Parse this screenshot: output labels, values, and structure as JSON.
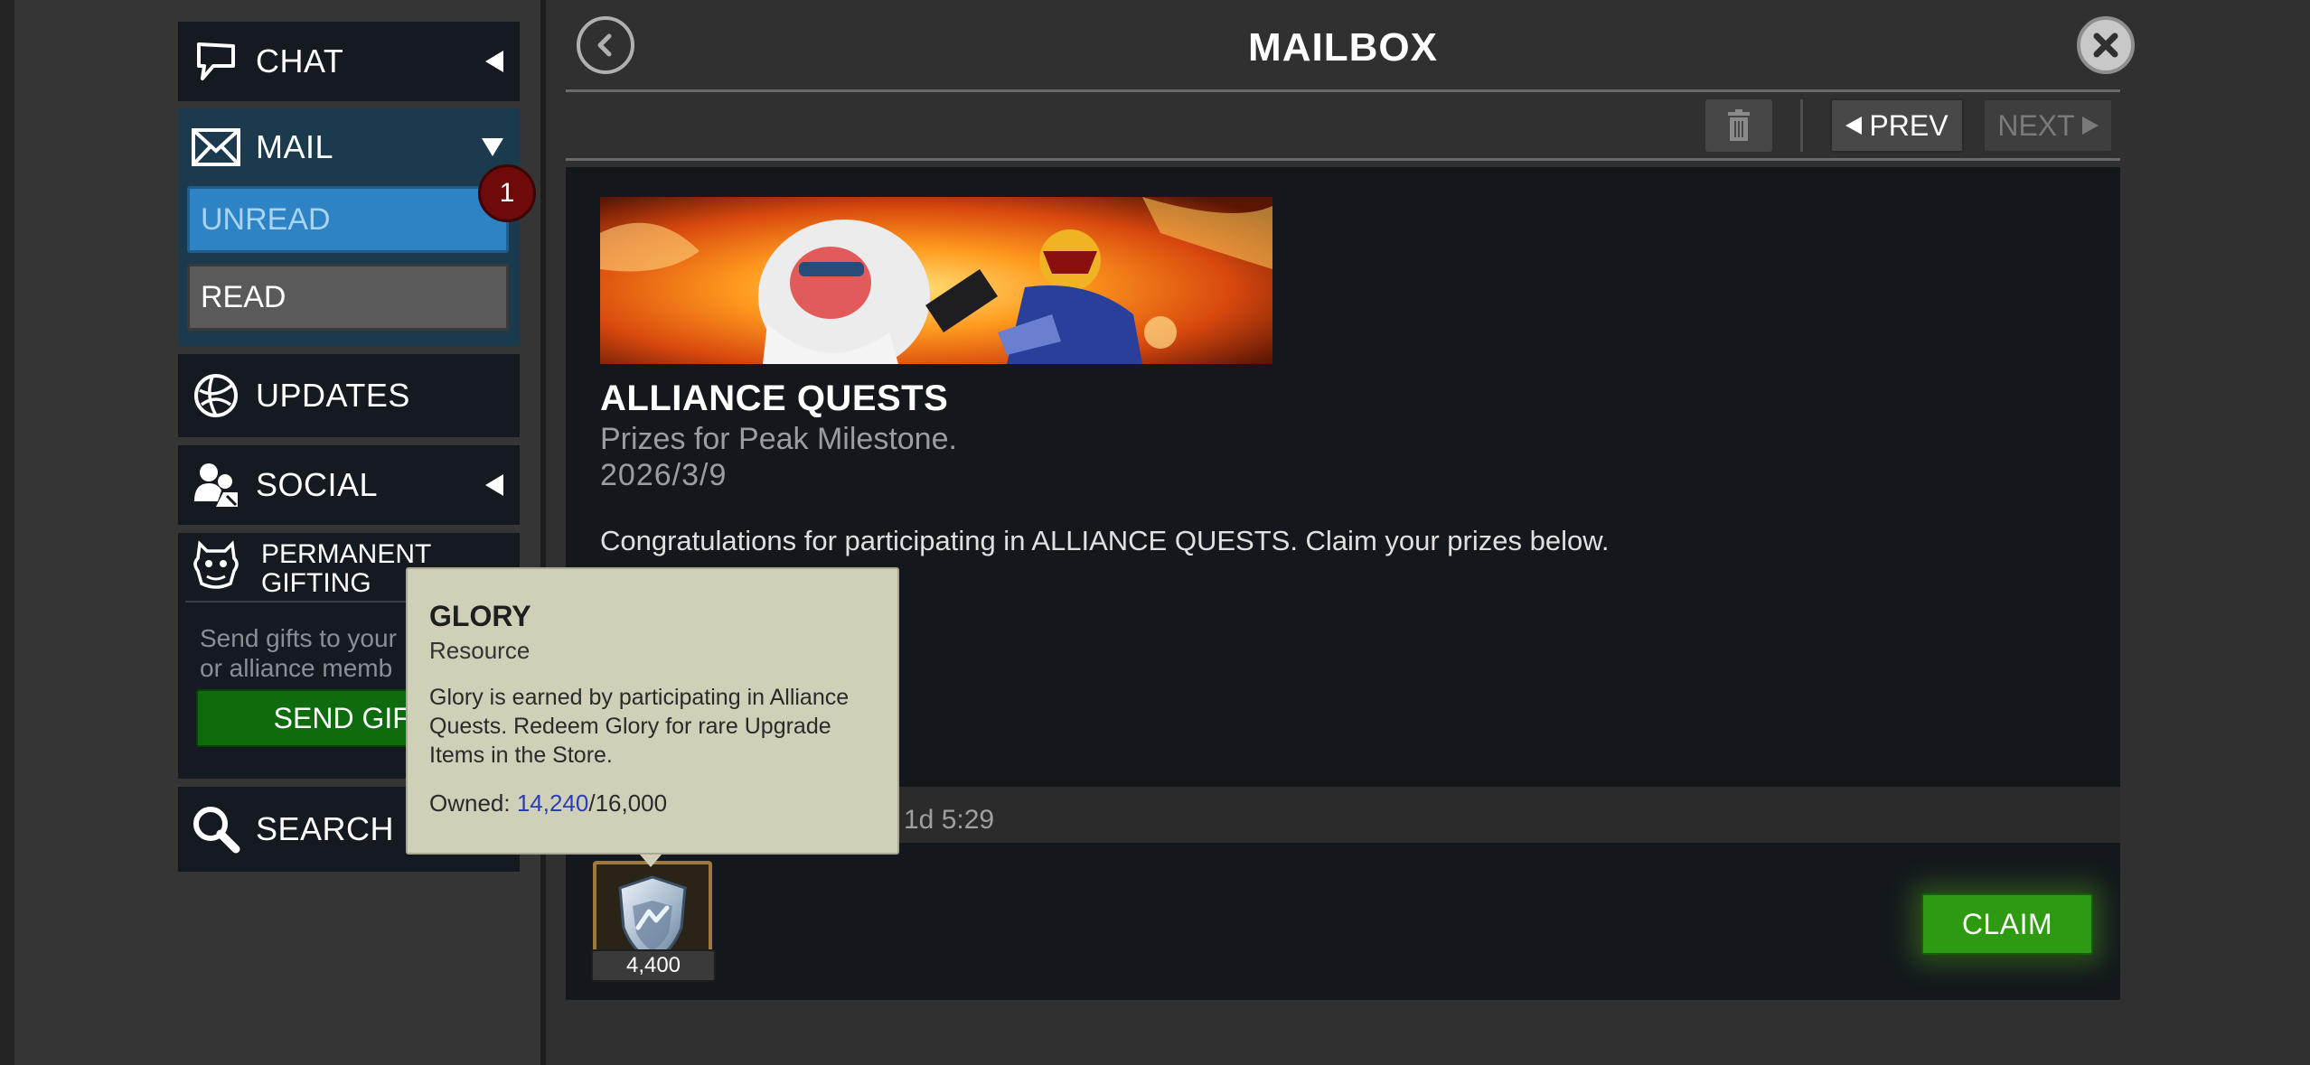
{
  "sidebar": {
    "chat_label": "CHAT",
    "mail_label": "MAIL",
    "unread_label": "UNREAD",
    "unread_count": "1",
    "read_label": "READ",
    "updates_label": "UPDATES",
    "social_label": "SOCIAL",
    "gifting_label_line1": "PERMANENT",
    "gifting_label_line2": "GIFTING",
    "gifting_desc": "Send gifts to your\nor alliance memb",
    "send_gift_label": "SEND GIFT",
    "search_label": "SEARCH"
  },
  "header": {
    "title": "MAILBOX"
  },
  "toolbar": {
    "prev_label": "PREV",
    "next_label": "NEXT"
  },
  "message": {
    "title": "ALLIANCE QUESTS",
    "subtitle": "Prizes for Peak Milestone.",
    "date": "2026/3/9",
    "body": "Congratulations for participating in ALLIANCE QUESTS. Claim your prizes below.",
    "expires_in": "1d 5:29"
  },
  "reward": {
    "quantity": "4,400",
    "claim_label": "CLAIM"
  },
  "tooltip": {
    "title": "GLORY",
    "type": "Resource",
    "description": "Glory is earned by participating in Alliance Quests. Redeem Glory for rare Upgrade Items in the Store.",
    "owned_label": "Owned: ",
    "owned_value": "14,240",
    "owned_max": "/16,000"
  },
  "icons": [
    "chat-icon",
    "mail-icon",
    "updates-icon",
    "social-icon",
    "gifting-icon",
    "search-icon",
    "back-icon",
    "close-icon",
    "trash-icon",
    "glory-shield-icon"
  ],
  "colors": {
    "accent_blue": "#2e83c4",
    "claim_green": "#2d9a12",
    "send_gift_green": "#0e6b0e",
    "badge_red": "#6e0a0a",
    "tooltip_bg": "#d0cfb7"
  }
}
